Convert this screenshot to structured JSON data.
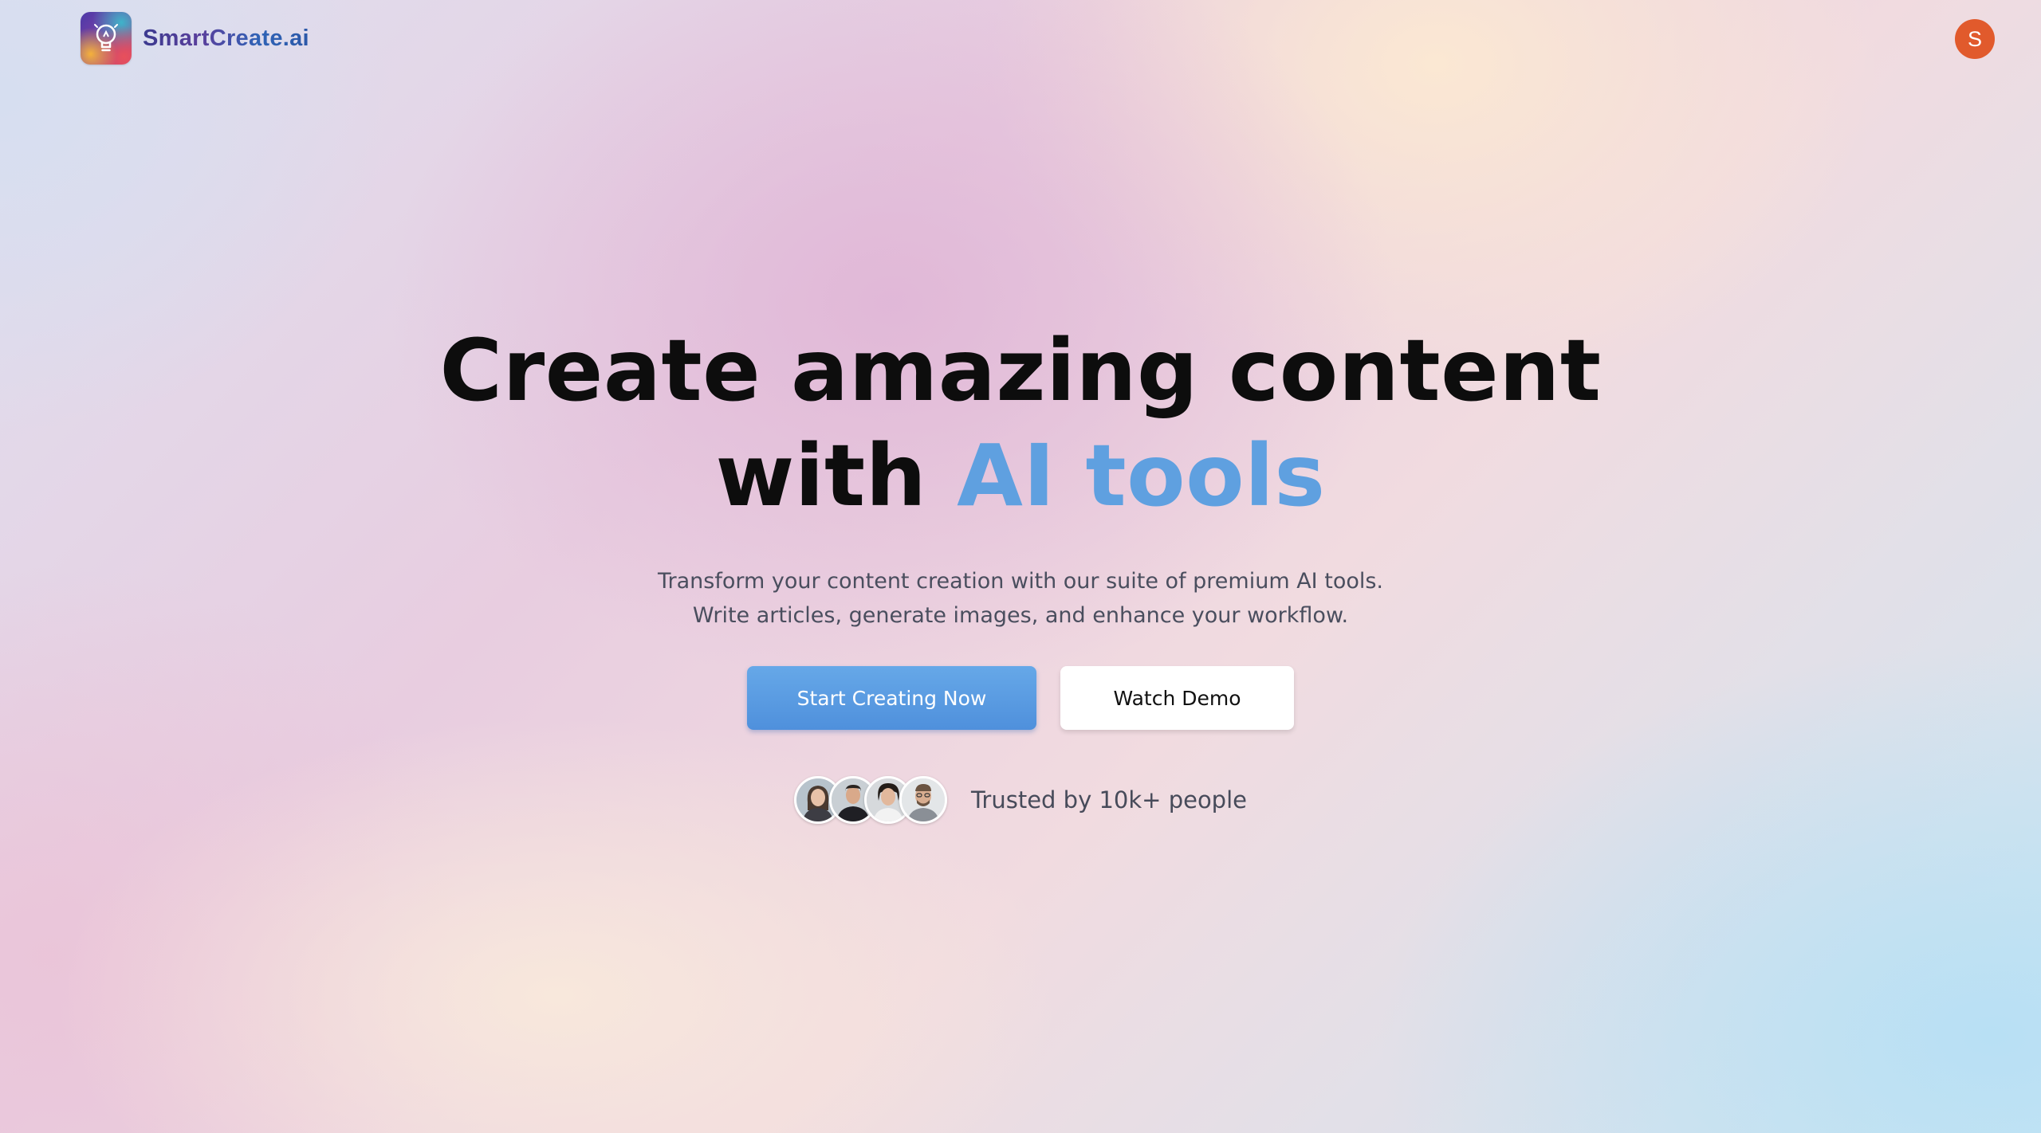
{
  "brand": {
    "name": "SmartCreate.ai",
    "logo_icon": "lightbulb-icon"
  },
  "user": {
    "avatar_initial": "S",
    "avatar_color": "#e15a2c"
  },
  "hero": {
    "headline_line1": "Create amazing content",
    "headline_line2_prefix": "with",
    "headline_line2_accent": "AI tools",
    "accent_color": "#5fa0e0",
    "subtitle_line1": "Transform your content creation with our suite of premium AI tools.",
    "subtitle_line2": "Write articles, generate images, and enhance your workflow."
  },
  "cta": {
    "primary_label": "Start Creating Now",
    "primary_color": "#5b9ce2",
    "secondary_label": "Watch Demo"
  },
  "social_proof": {
    "text": "Trusted by 10k+ people",
    "avatars": [
      "person-avatar-1",
      "person-avatar-2",
      "person-avatar-3",
      "person-avatar-4"
    ]
  }
}
